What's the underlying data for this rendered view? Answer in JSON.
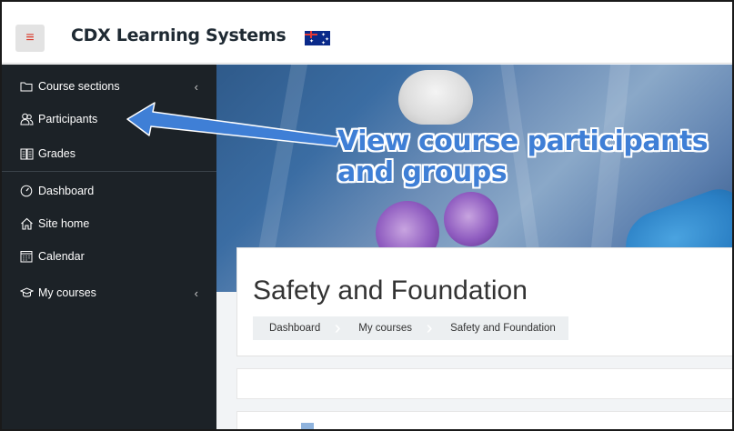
{
  "navbar": {
    "menu_icon": "hamburger-icon",
    "brand_prefix": "CDX",
    "brand_suffix": " Learning Systems",
    "flag_icon": "australia-flag-icon"
  },
  "sidebar": {
    "items": [
      {
        "label": "Course sections",
        "icon": "folder-icon",
        "chevron": "‹"
      },
      {
        "label": "Participants",
        "icon": "users-icon"
      },
      {
        "label": "Grades",
        "icon": "gradebook-icon"
      },
      {
        "label": "Dashboard",
        "icon": "dashboard-gauge-icon"
      },
      {
        "label": "Site home",
        "icon": "home-icon"
      },
      {
        "label": "Calendar",
        "icon": "calendar-icon"
      },
      {
        "label": "My courses",
        "icon": "graduation-cap-icon",
        "chevron": "‹"
      }
    ]
  },
  "hero": {
    "annotation_line1": "View course participants",
    "annotation_line2": "and groups"
  },
  "course": {
    "title": "Safety and Foundation",
    "breadcrumb": [
      "Dashboard",
      "My courses",
      "Safety and Foundation"
    ]
  },
  "colors": {
    "sidebar_bg": "#1c2227",
    "annotation_blue": "#3f7fd6",
    "brand_x_red": "#c62828"
  }
}
